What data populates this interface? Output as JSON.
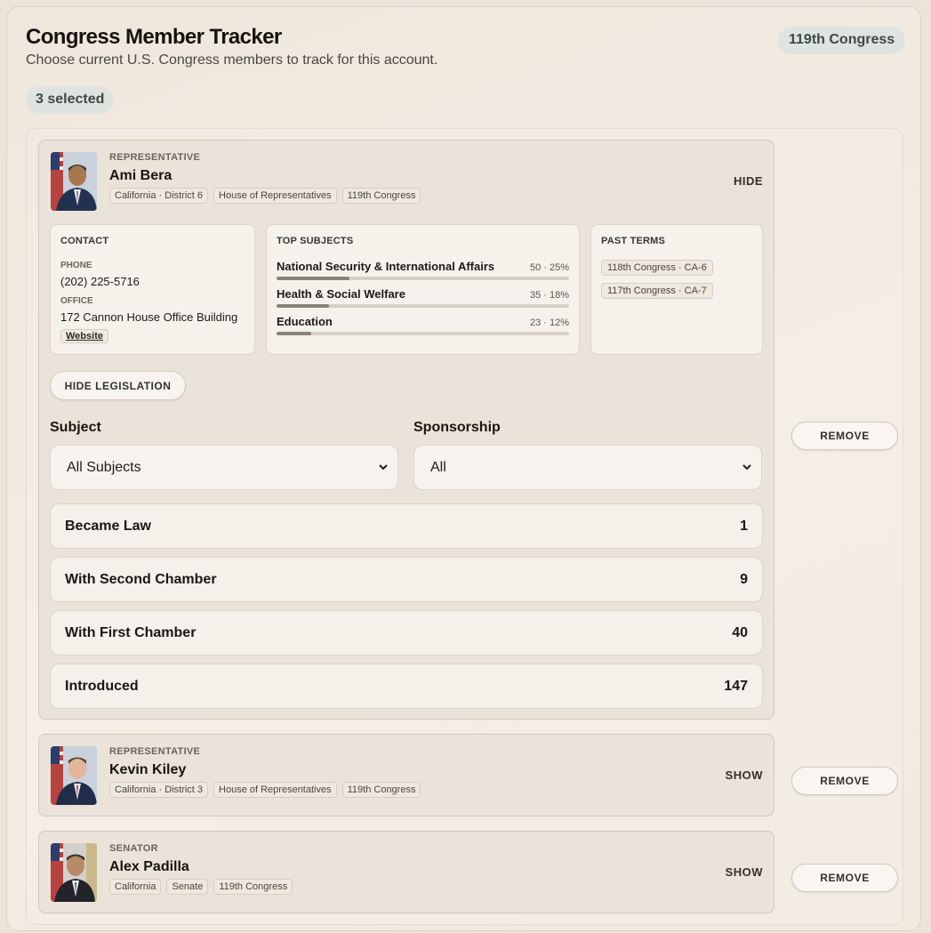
{
  "header": {
    "title": "Congress Member Tracker",
    "subtitle": "Choose current U.S. Congress members to track for this account.",
    "congress_badge": "119th Congress",
    "selected_count": "3 selected"
  },
  "members": [
    {
      "role": "REPRESENTATIVE",
      "name": "Ami Bera",
      "tags": [
        "California · District 6",
        "House of Representatives",
        "119th Congress"
      ],
      "toggle_label": "HIDE",
      "remove_label": "REMOVE",
      "contact": {
        "heading": "CONTACT",
        "phone_label": "PHONE",
        "phone": "(202) 225-5716",
        "office_label": "OFFICE",
        "office": "172 Cannon House Office Building",
        "website_label": "Website"
      },
      "top_subjects": {
        "heading": "TOP SUBJECTS",
        "items": [
          {
            "name": "National Security & International Affairs",
            "stat": "50 · 25%",
            "share": 0.25
          },
          {
            "name": "Health & Social Welfare",
            "stat": "35 · 18%",
            "share": 0.18
          },
          {
            "name": "Education",
            "stat": "23 · 12%",
            "share": 0.12
          }
        ]
      },
      "past_terms": {
        "heading": "PAST TERMS",
        "items": [
          "118th Congress · CA-6",
          "117th Congress · CA-7"
        ]
      },
      "legislation": {
        "hide_button": "HIDE LEGISLATION",
        "subject_label": "Subject",
        "subject_value": "All Subjects",
        "sponsorship_label": "Sponsorship",
        "sponsorship_value": "All",
        "statuses": [
          {
            "label": "Became Law",
            "count": "1"
          },
          {
            "label": "With Second Chamber",
            "count": "9"
          },
          {
            "label": "With First Chamber",
            "count": "40"
          },
          {
            "label": "Introduced",
            "count": "147"
          }
        ]
      }
    },
    {
      "role": "REPRESENTATIVE",
      "name": "Kevin Kiley",
      "tags": [
        "California · District 3",
        "House of Representatives",
        "119th Congress"
      ],
      "toggle_label": "SHOW",
      "remove_label": "REMOVE"
    },
    {
      "role": "SENATOR",
      "name": "Alex Padilla",
      "tags": [
        "California",
        "Senate",
        "119th Congress"
      ],
      "toggle_label": "SHOW",
      "remove_label": "REMOVE"
    }
  ],
  "icons": {
    "dropdown": "chevron-down-icon",
    "portrait": "member-portrait"
  },
  "colors": {
    "background": "#ede4d9",
    "card": "#ebe3d9",
    "badge": "#dfe4e0",
    "badge_text": "#3c4a46",
    "bar_fill": "#8a8378"
  }
}
